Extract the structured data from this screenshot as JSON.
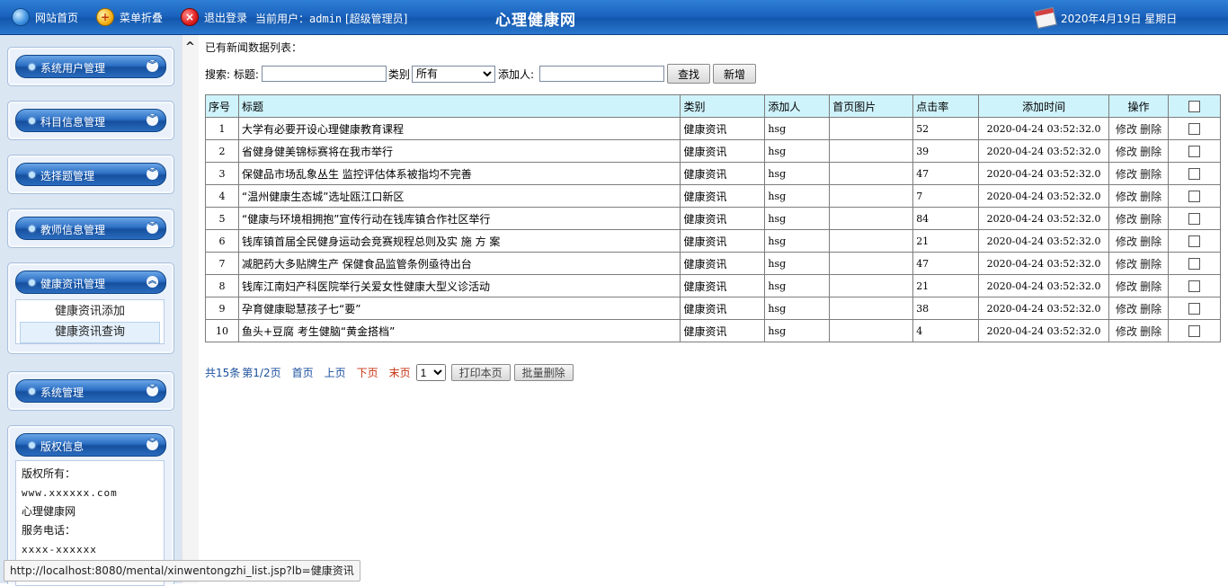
{
  "topbar": {
    "home": "网站首页",
    "favorite": "菜单折叠",
    "logout": "退出登录",
    "user_label": "当前用户：",
    "user_name": "admin",
    "user_role": "[超级管理员]",
    "title": "心理健康网",
    "date": "2020年4月19日 星期日"
  },
  "sidebar": {
    "sections": [
      {
        "label": "系统用户管理"
      },
      {
        "label": "科目信息管理"
      },
      {
        "label": "选择题管理"
      },
      {
        "label": "教师信息管理"
      },
      {
        "label": "健康资讯管理",
        "items": [
          "健康资讯添加",
          "健康资讯查询"
        ]
      },
      {
        "label": "系统管理"
      },
      {
        "label": "版权信息"
      }
    ],
    "copyright": {
      "owner_label": "版权所有：",
      "url": "www.xxxxxx.com",
      "site": "心理健康网",
      "phone_label": "服务电话：",
      "phone": "xxxx-xxxxxx"
    }
  },
  "main": {
    "heading": "已有新闻数据列表：",
    "search": {
      "search_label": "搜索:",
      "title_label": "标题:",
      "category_label": "类别",
      "category_value": "所有",
      "adder_label": "添加人:",
      "search_btn": "查找",
      "new_btn": "新增"
    },
    "columns": [
      "序号",
      "标题",
      "类别",
      "添加人",
      "首页图片",
      "点击率",
      "添加时间",
      "操作"
    ],
    "rows": [
      {
        "no": "1",
        "title": "大学有必要开设心理健康教育课程",
        "category": "健康资讯",
        "adder": "hsg",
        "image": "",
        "clicks": "52",
        "time": "2020-04-24 03:52:32.0"
      },
      {
        "no": "2",
        "title": "省健身健美锦标赛将在我市举行",
        "category": "健康资讯",
        "adder": "hsg",
        "image": "",
        "clicks": "39",
        "time": "2020-04-24 03:52:32.0"
      },
      {
        "no": "3",
        "title": "保健品市场乱象丛生 监控评估体系被指均不完善",
        "category": "健康资讯",
        "adder": "hsg",
        "image": "",
        "clicks": "47",
        "time": "2020-04-24 03:52:32.0"
      },
      {
        "no": "4",
        "title": "“温州健康生态城”选址瓯江口新区",
        "category": "健康资讯",
        "adder": "hsg",
        "image": "",
        "clicks": "7",
        "time": "2020-04-24 03:52:32.0"
      },
      {
        "no": "5",
        "title": "“健康与环境相拥抱”宣传行动在钱库镇合作社区举行",
        "category": "健康资讯",
        "adder": "hsg",
        "image": "",
        "clicks": "84",
        "time": "2020-04-24 03:52:32.0"
      },
      {
        "no": "6",
        "title": "钱库镇首届全民健身运动会竞赛规程总则及实 施 方 案",
        "category": "健康资讯",
        "adder": "hsg",
        "image": "",
        "clicks": "21",
        "time": "2020-04-24 03:52:32.0"
      },
      {
        "no": "7",
        "title": "减肥药大多贴牌生产 保健食品监管条例亟待出台",
        "category": "健康资讯",
        "adder": "hsg",
        "image": "",
        "clicks": "47",
        "time": "2020-04-24 03:52:32.0"
      },
      {
        "no": "8",
        "title": "钱库江南妇产科医院举行关爱女性健康大型义诊活动",
        "category": "健康资讯",
        "adder": "hsg",
        "image": "",
        "clicks": "21",
        "time": "2020-04-24 03:52:32.0"
      },
      {
        "no": "9",
        "title": "孕育健康聪慧孩子七“要”",
        "category": "健康资讯",
        "adder": "hsg",
        "image": "",
        "clicks": "38",
        "time": "2020-04-24 03:52:32.0"
      },
      {
        "no": "10",
        "title": "鱼头+豆腐 考生健脑“黄金搭档”",
        "category": "健康资讯",
        "adder": "hsg",
        "image": "",
        "clicks": "4",
        "time": "2020-04-24 03:52:32.0"
      }
    ],
    "action_edit": "修改",
    "action_delete": "删除",
    "pager": {
      "total": "共15条",
      "page": "第1/2页",
      "first": "首页",
      "prev": "上页",
      "next": "下页",
      "last": "末页",
      "page_select": "1",
      "print_btn": "打印本页",
      "batch_delete_btn": "批量删除"
    }
  },
  "statusbar": "http://localhost:8080/mental/xinwentongzhi_list.jsp?lb=健康资讯",
  "colors": {
    "accent": "#1b64bf",
    "header_cell": "#cff3fb",
    "link": "#1a4f9c",
    "link_red": "#c8320f"
  }
}
